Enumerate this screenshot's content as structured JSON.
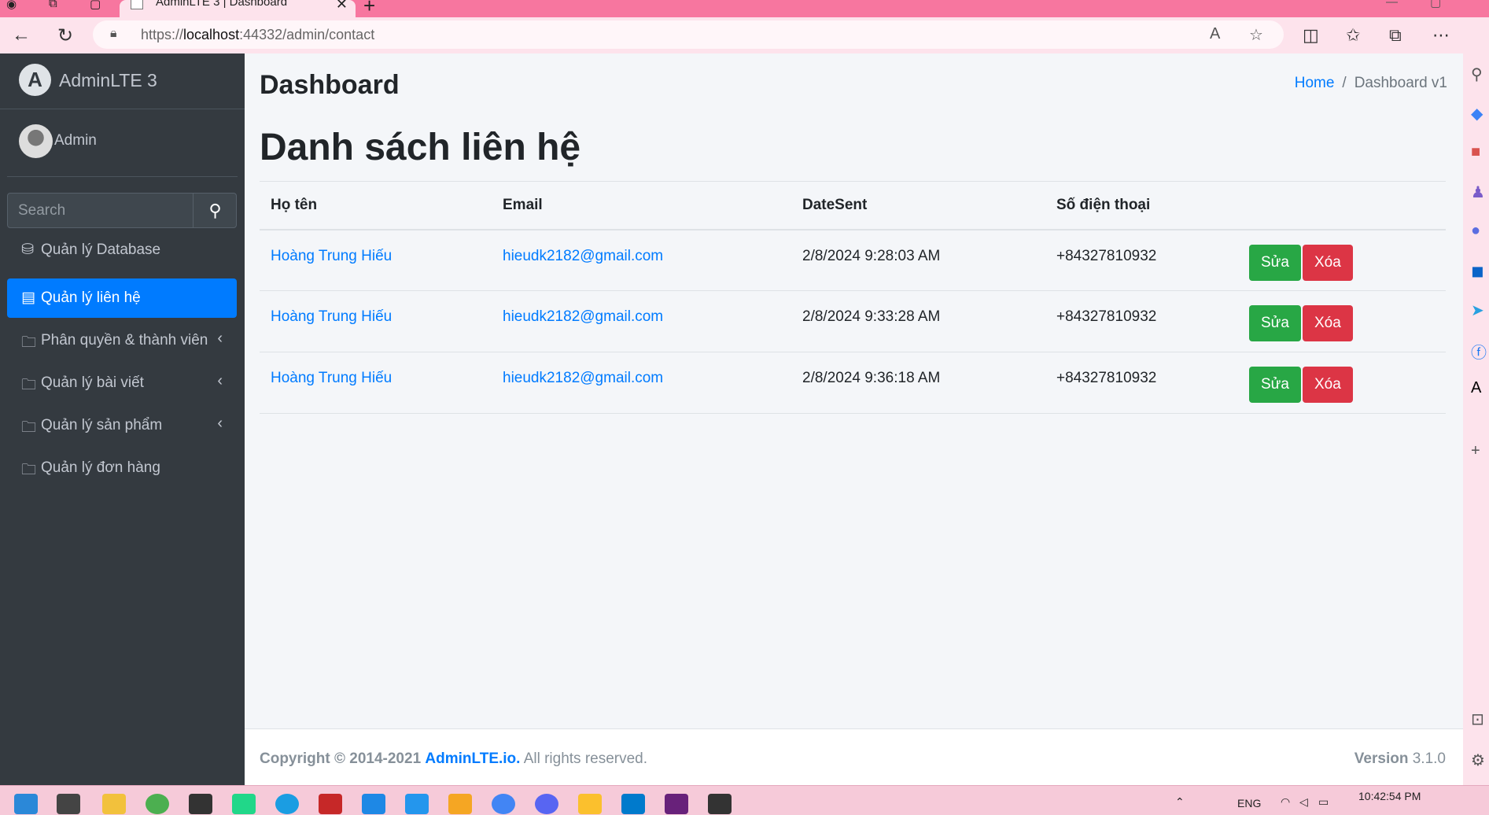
{
  "browser": {
    "tab_title": "AdminLTE 3 | Dashboard",
    "url_host": "localhost",
    "url_prefix": "https://",
    "url_rest": ":44332/admin/contact"
  },
  "sidebar": {
    "brand": "AdminLTE 3",
    "user": "Admin",
    "search_placeholder": "Search",
    "items": [
      {
        "label": "Quản lý Database",
        "icon": "database-icon"
      },
      {
        "label": "Quản lý liên hệ",
        "icon": "contact-card-icon",
        "active": true
      },
      {
        "label": "Phân quyền & thành viên",
        "icon": "folder-icon",
        "has_children": true
      },
      {
        "label": "Quản lý bài viết",
        "icon": "folder-icon",
        "has_children": true
      },
      {
        "label": "Quản lý sản phẩm",
        "icon": "folder-icon",
        "has_children": true
      },
      {
        "label": "Quản lý đơn hàng",
        "icon": "folder-icon"
      }
    ]
  },
  "header": {
    "title": "Dashboard",
    "breadcrumb_home": "Home",
    "breadcrumb_sep": "/",
    "breadcrumb_current": "Dashboard v1"
  },
  "main": {
    "page_title": "Danh sách liên hệ",
    "columns": [
      "Họ tên",
      "Email",
      "DateSent",
      "Số điện thoại"
    ],
    "rows": [
      {
        "name": "Hoàng Trung Hiếu",
        "email": "hieudk2182@gmail.com",
        "date": "2/8/2024 9:28:03 AM",
        "phone": "+84327810932"
      },
      {
        "name": "Hoàng Trung Hiếu",
        "email": "hieudk2182@gmail.com",
        "date": "2/8/2024 9:33:28 AM",
        "phone": "+84327810932"
      },
      {
        "name": "Hoàng Trung Hiếu",
        "email": "hieudk2182@gmail.com",
        "date": "2/8/2024 9:36:18 AM",
        "phone": "+84327810932"
      }
    ],
    "edit_label": "Sửa",
    "delete_label": "Xóa"
  },
  "footer": {
    "copyright": "Copyright © 2014-2021",
    "brand_link": "AdminLTE.io.",
    "rights": "All rights reserved.",
    "version_label": "Version",
    "version": "3.1.0"
  },
  "taskbar": {
    "lang": "ENG",
    "time": "10:42:54 PM"
  },
  "colors": {
    "primary": "#007bff",
    "success": "#28a745",
    "danger": "#dc3545",
    "sidebar_bg": "#343a40"
  }
}
